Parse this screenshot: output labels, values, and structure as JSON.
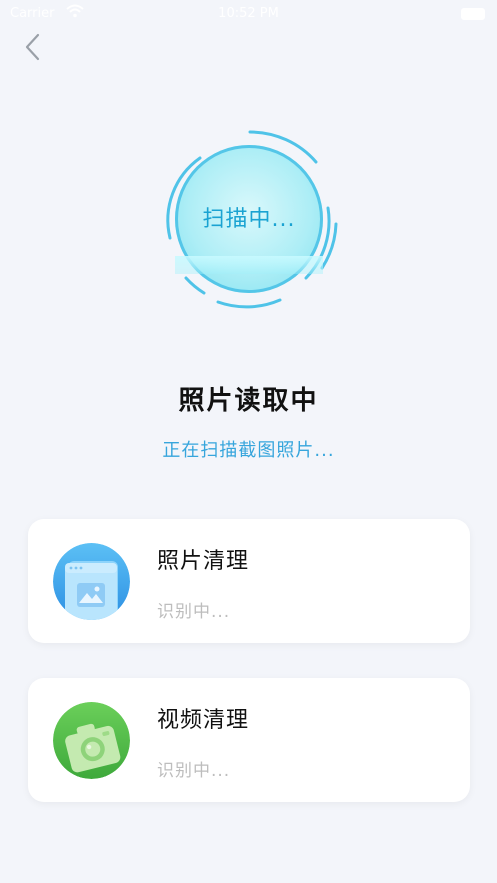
{
  "status_bar": {
    "carrier": "Carrier",
    "time": "10:52 PM"
  },
  "header": {
    "back_icon": "chevron-left-icon"
  },
  "scan": {
    "label": "扫描中..."
  },
  "main": {
    "title": "照片读取中",
    "subtitle": "正在扫描截图照片..."
  },
  "cards": [
    {
      "title": "照片清理",
      "status": "识别中...",
      "icon": "photo-gallery-icon",
      "color": "#3fa9ee"
    },
    {
      "title": "视频清理",
      "status": "识别中...",
      "icon": "video-camera-icon",
      "color": "#5bc24e"
    }
  ],
  "colors": {
    "background": "#f3f5fa",
    "accent": "#36a5dc",
    "scan_ring": "#54c6e8"
  }
}
